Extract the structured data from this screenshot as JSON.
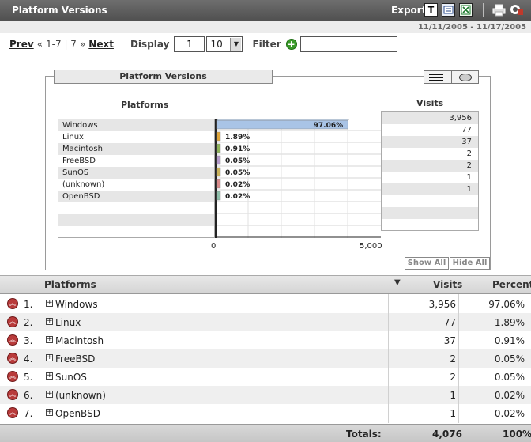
{
  "header": {
    "title": "Platform Versions",
    "export_label": "Export",
    "date_range": "11/11/2005 - 11/17/2005"
  },
  "pager": {
    "prev": "Prev",
    "range": "1-7 | 7",
    "next": "Next",
    "display_label": "Display",
    "start_value": "1",
    "per_page": "10",
    "filter_label": "Filter",
    "filter_value": ""
  },
  "chart_panel": {
    "title": "Platform Versions",
    "platforms_header": "Platforms",
    "visits_header": "Visits",
    "axis_min": "0",
    "axis_max": "5,000",
    "show_all": "Show All",
    "hide_all": "Hide All"
  },
  "chart_data": {
    "type": "bar",
    "orientation": "horizontal",
    "categories": [
      "Windows",
      "Linux",
      "Macintosh",
      "FreeBSD",
      "SunOS",
      "(unknown)",
      "OpenBSD"
    ],
    "values": [
      3956,
      77,
      37,
      2,
      2,
      1,
      1
    ],
    "percent_labels": [
      "97.06%",
      "1.89%",
      "0.91%",
      "0.05%",
      "0.05%",
      "0.02%",
      "0.02%"
    ],
    "visit_labels": [
      "3,956",
      "77",
      "37",
      "2",
      "2",
      "1",
      "1"
    ],
    "xlim": [
      0,
      5000
    ],
    "colors": [
      "#a9c4e6",
      "#e0a63a",
      "#8fb35a",
      "#b49ac9",
      "#c9b15a",
      "#d88a8a",
      "#8fbfaa"
    ],
    "grid": true
  },
  "table": {
    "col_platforms": "Platforms",
    "col_visits": "Visits",
    "col_percent": "Percent",
    "rows": [
      {
        "rank": "1.",
        "name": "Windows",
        "visits": "3,956",
        "percent": "97.06%"
      },
      {
        "rank": "2.",
        "name": "Linux",
        "visits": "77",
        "percent": "1.89%"
      },
      {
        "rank": "3.",
        "name": "Macintosh",
        "visits": "37",
        "percent": "0.91%"
      },
      {
        "rank": "4.",
        "name": "FreeBSD",
        "visits": "2",
        "percent": "0.05%"
      },
      {
        "rank": "5.",
        "name": "SunOS",
        "visits": "2",
        "percent": "0.05%"
      },
      {
        "rank": "6.",
        "name": "(unknown)",
        "visits": "1",
        "percent": "0.02%"
      },
      {
        "rank": "7.",
        "name": "OpenBSD",
        "visits": "1",
        "percent": "0.02%"
      }
    ],
    "totals_label": "Totals:",
    "totals_visits": "4,076",
    "totals_percent": "100%"
  },
  "icons": {
    "export_text": "T",
    "export_xml": "xml-icon",
    "export_excel": "excel-icon",
    "print": "printer-icon",
    "settings": "settings-icon"
  }
}
